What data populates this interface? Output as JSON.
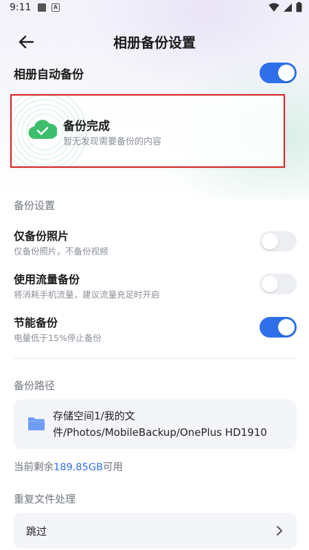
{
  "status_bar": {
    "time": "9:11",
    "icons": [
      "square-notification-icon",
      "a-notification-icon",
      "wifi-icon",
      "signal-icon",
      "battery-icon"
    ]
  },
  "header": {
    "title": "相册备份设置",
    "back_icon": "arrow-left-icon"
  },
  "auto_backup": {
    "label": "相册自动备份",
    "enabled": true
  },
  "status_card": {
    "title": "备份完成",
    "subtitle": "暂无发现需要备份的内容",
    "icon": "cloud-check-icon",
    "icon_color": "#3ebd6d"
  },
  "backup_settings": {
    "section_label": "备份设置",
    "items": [
      {
        "title": "仅备份照片",
        "subtitle": "仅备份照片，不备份视频",
        "enabled": false
      },
      {
        "title": "使用流量备份",
        "subtitle": "将消耗手机流量，建议流量充足时开启",
        "enabled": false
      },
      {
        "title": "节能备份",
        "subtitle": "电量低于15%停止备份",
        "enabled": true
      }
    ]
  },
  "backup_path": {
    "section_label": "备份路径",
    "path": "存储空间1/我的文件/Photos/MobileBackup/OnePlus HD1910",
    "icon": "folder-icon"
  },
  "free_space": {
    "prefix": "当前剩余",
    "value": "189.85GB",
    "suffix": "可用"
  },
  "duplicate": {
    "section_label": "重复文件处理",
    "value": "跳过"
  },
  "colors": {
    "accent": "#2f6fea",
    "highlight_border": "#d42020",
    "success": "#3ebd6d",
    "folder": "#6f9cf5"
  }
}
